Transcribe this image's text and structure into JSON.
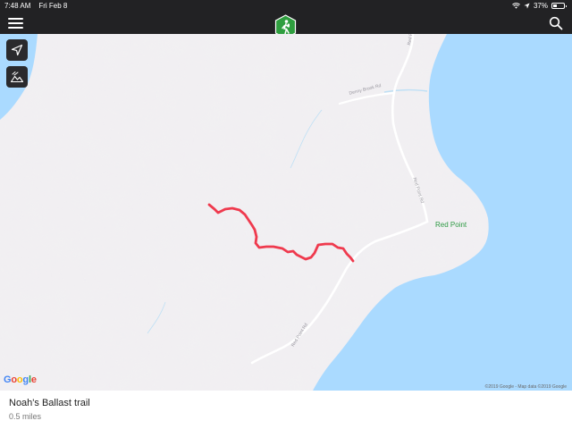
{
  "status_bar": {
    "time": "7:48 AM",
    "date": "Fri Feb 8",
    "battery_text": "37%",
    "battery_level": 0.37
  },
  "nav": {
    "menu_icon": "hamburger-menu-icon",
    "logo_icon": "hiker-logo-icon",
    "search_icon": "search-icon"
  },
  "map": {
    "controls": [
      {
        "icon": "location-arrow-icon"
      },
      {
        "icon": "terrain-layer-icon"
      }
    ],
    "road_labels": {
      "red_point_rd_top": "Red Point Rd",
      "denny_brook_rd": "Denny Brook Rd",
      "red_point_rd_mid": "Red Point Rd",
      "red_point_rd_bottom": "Red Point Rd"
    },
    "poi_label": "Red Point",
    "attribution": "©2019 Google - Map data ©2019 Google",
    "colors": {
      "land": "#f1eff2",
      "water": "#aadaff",
      "trail": "#ef3a4e",
      "poi": "#2e9a44"
    }
  },
  "trail": {
    "name": "Noah's Ballast trail",
    "distance": "0.5 miles"
  }
}
